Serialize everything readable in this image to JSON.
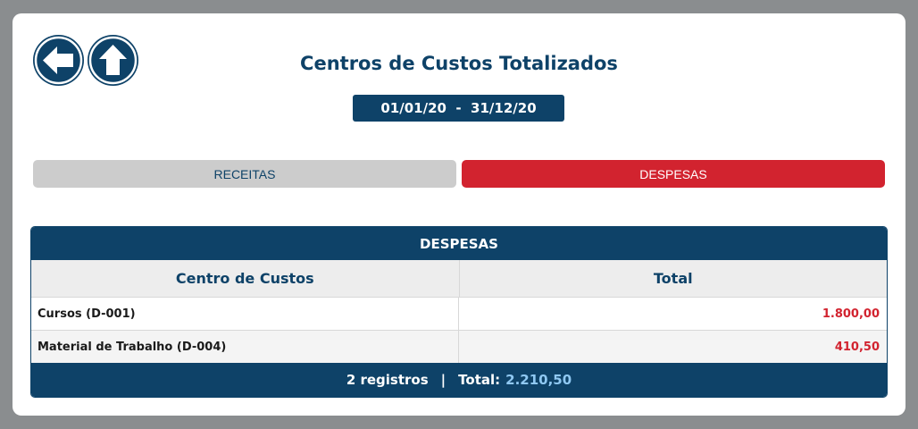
{
  "page": {
    "title": "Centros de Custos Totalizados",
    "date_range": "01/01/20  -  31/12/20"
  },
  "nav": {
    "back_icon": "arrow-left-icon",
    "up_icon": "arrow-up-icon"
  },
  "tabs": [
    {
      "label": "RECEITAS",
      "active": false
    },
    {
      "label": "DESPESAS",
      "active": true
    }
  ],
  "table": {
    "title": "DESPESAS",
    "columns": [
      "Centro de Custos",
      "Total"
    ],
    "rows": [
      {
        "name": "Cursos (D-001)",
        "total": "1.800,00"
      },
      {
        "name": "Material de Trabalho (D-004)",
        "total": "410,50"
      }
    ],
    "footer": {
      "count": "2 registros",
      "separator": "|",
      "total_label": "Total:",
      "total_value": "2.210,50"
    }
  },
  "colors": {
    "primary": "#0e4268",
    "accent_red": "#d2232f",
    "tab_inactive": "#cccccc",
    "total_highlight": "#8fc8f2"
  }
}
